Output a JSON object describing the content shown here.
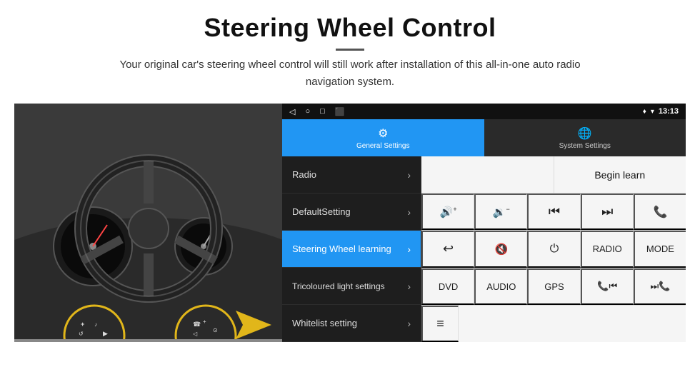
{
  "header": {
    "title": "Steering Wheel Control",
    "subtitle": "Your original car's steering wheel control will still work after installation of this all-in-one auto radio navigation system."
  },
  "status_bar": {
    "icons": [
      "◁",
      "○",
      "□",
      "⬛"
    ],
    "right_icons": [
      "♥",
      "▾"
    ],
    "time": "13:13"
  },
  "tabs": [
    {
      "id": "general",
      "icon": "⚙",
      "label": "General Settings",
      "active": true
    },
    {
      "id": "system",
      "icon": "🌐",
      "label": "System Settings",
      "active": false
    }
  ],
  "menu_items": [
    {
      "id": "radio",
      "label": "Radio",
      "active": false
    },
    {
      "id": "default",
      "label": "DefaultSetting",
      "active": false
    },
    {
      "id": "steering",
      "label": "Steering Wheel learning",
      "active": true
    },
    {
      "id": "tricoloured",
      "label": "Tricoloured light settings",
      "active": false
    },
    {
      "id": "whitelist",
      "label": "Whitelist setting",
      "active": false
    }
  ],
  "controls": {
    "begin_learn_label": "Begin learn",
    "rows": [
      [
        {
          "id": "vol-up",
          "label": "🔊+",
          "type": "icon"
        },
        {
          "id": "vol-down",
          "label": "🔉−",
          "type": "icon"
        },
        {
          "id": "prev-track",
          "label": "⏮",
          "type": "icon"
        },
        {
          "id": "next-track",
          "label": "⏭",
          "type": "icon"
        },
        {
          "id": "phone",
          "label": "📞",
          "type": "icon"
        }
      ],
      [
        {
          "id": "back",
          "label": "↩",
          "type": "icon"
        },
        {
          "id": "mute",
          "label": "🔇×",
          "type": "icon"
        },
        {
          "id": "power",
          "label": "⏻",
          "type": "icon"
        },
        {
          "id": "radio-btn",
          "label": "RADIO",
          "type": "text"
        },
        {
          "id": "mode-btn",
          "label": "MODE",
          "type": "text"
        }
      ],
      [
        {
          "id": "dvd-btn",
          "label": "DVD",
          "type": "text"
        },
        {
          "id": "audio-btn",
          "label": "AUDIO",
          "type": "text"
        },
        {
          "id": "gps-btn",
          "label": "GPS",
          "type": "text"
        },
        {
          "id": "prev-combo",
          "label": "📞⏮",
          "type": "icon"
        },
        {
          "id": "next-combo",
          "label": "⏭📞",
          "type": "icon"
        }
      ],
      [
        {
          "id": "menu-icon",
          "label": "≡",
          "type": "icon"
        }
      ]
    ]
  }
}
